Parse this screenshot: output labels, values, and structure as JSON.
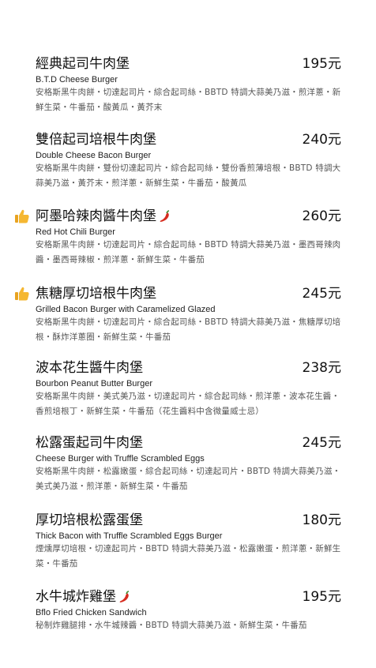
{
  "items": [
    {
      "name": "經典起司牛肉堡",
      "price": "195元",
      "english": "B.T.D Cheese Burger",
      "desc": "安格斯黑牛肉餅・切達起司片・綜合起司絲・BBTD 特調大蒜美乃滋・煎洋蔥・新鮮生菜・牛番茄・酸黃瓜・黃芥末",
      "recommended": false,
      "spicy": false
    },
    {
      "name": "雙倍起司培根牛肉堡",
      "price": "240元",
      "english": "Double Cheese Bacon Burger",
      "desc": "安格斯黑牛肉餅・雙份切達起司片・綜合起司絲・雙份香煎薄培根・BBTD 特調大蒜美乃滋・黃芥末・煎洋蔥・新鮮生菜・牛番茄・酸黃瓜",
      "recommended": false,
      "spicy": false
    },
    {
      "name": "阿墨哈辣肉醬牛肉堡",
      "price": "260元",
      "english": "Red Hot Chili Burger",
      "desc": "安格斯黑牛肉餅・切達起司片・綜合起司絲・BBTD 特調大蒜美乃滋・墨西哥辣肉醬・墨西哥辣椒・煎洋蔥・新鮮生菜・牛番茄",
      "recommended": true,
      "spicy": true
    },
    {
      "name": "焦糖厚切培根牛肉堡",
      "price": "245元",
      "english": "Grilled Bacon Burger with Caramelized Glazed",
      "desc": "安格斯黑牛肉餅・切達起司片・綜合起司絲・BBTD 特調大蒜美乃滋・焦糖厚切培根・酥炸洋蔥圈・新鮮生菜・牛番茄",
      "recommended": true,
      "spicy": false
    },
    {
      "name": "波本花生醬牛肉堡",
      "price": "238元",
      "english": "Bourbon Peanut Butter Burger",
      "desc": "安格斯黑牛肉餅・美式美乃滋・切達起司片・綜合起司絲・煎洋蔥・波本花生醬・香煎培根丁・新鮮生菜・牛番茄（花生醬料中含微量威士忌）",
      "recommended": false,
      "spicy": false
    },
    {
      "name": "松露蛋起司牛肉堡",
      "price": "245元",
      "english": "Cheese Burger with Truffle Scrambled Eggs",
      "desc": "安格斯黑牛肉餅・松露嫩蛋・綜合起司絲・切達起司片・BBTD 特調大蒜美乃滋・美式美乃滋・煎洋蔥・新鮮生菜・牛番茄",
      "recommended": false,
      "spicy": false
    },
    {
      "name": "厚切培根松露蛋堡",
      "price": "180元",
      "english": "Thick Bacon with Truffle Scrambled Eggs Burger",
      "desc": "煙燻厚切培根・切達起司片・BBTD 特調大蒜美乃滋・松露嫩蛋・煎洋蔥・新鮮生菜・牛番茄",
      "recommended": false,
      "spicy": false
    },
    {
      "name": "水牛城炸雞堡",
      "price": "195元",
      "english": "Bflo Fried Chicken Sandwich",
      "desc": "秘制炸雞腿排・水牛城辣醬・BBTD 特調大蒜美乃滋・新鮮生菜・牛番茄",
      "recommended": false,
      "spicy": true
    }
  ],
  "icons": {
    "recommend": "thumbs-up-icon",
    "spicy": "chili-pepper-icon"
  },
  "colors": {
    "thumb": "#f5b731",
    "chili": "#d62c1f"
  }
}
